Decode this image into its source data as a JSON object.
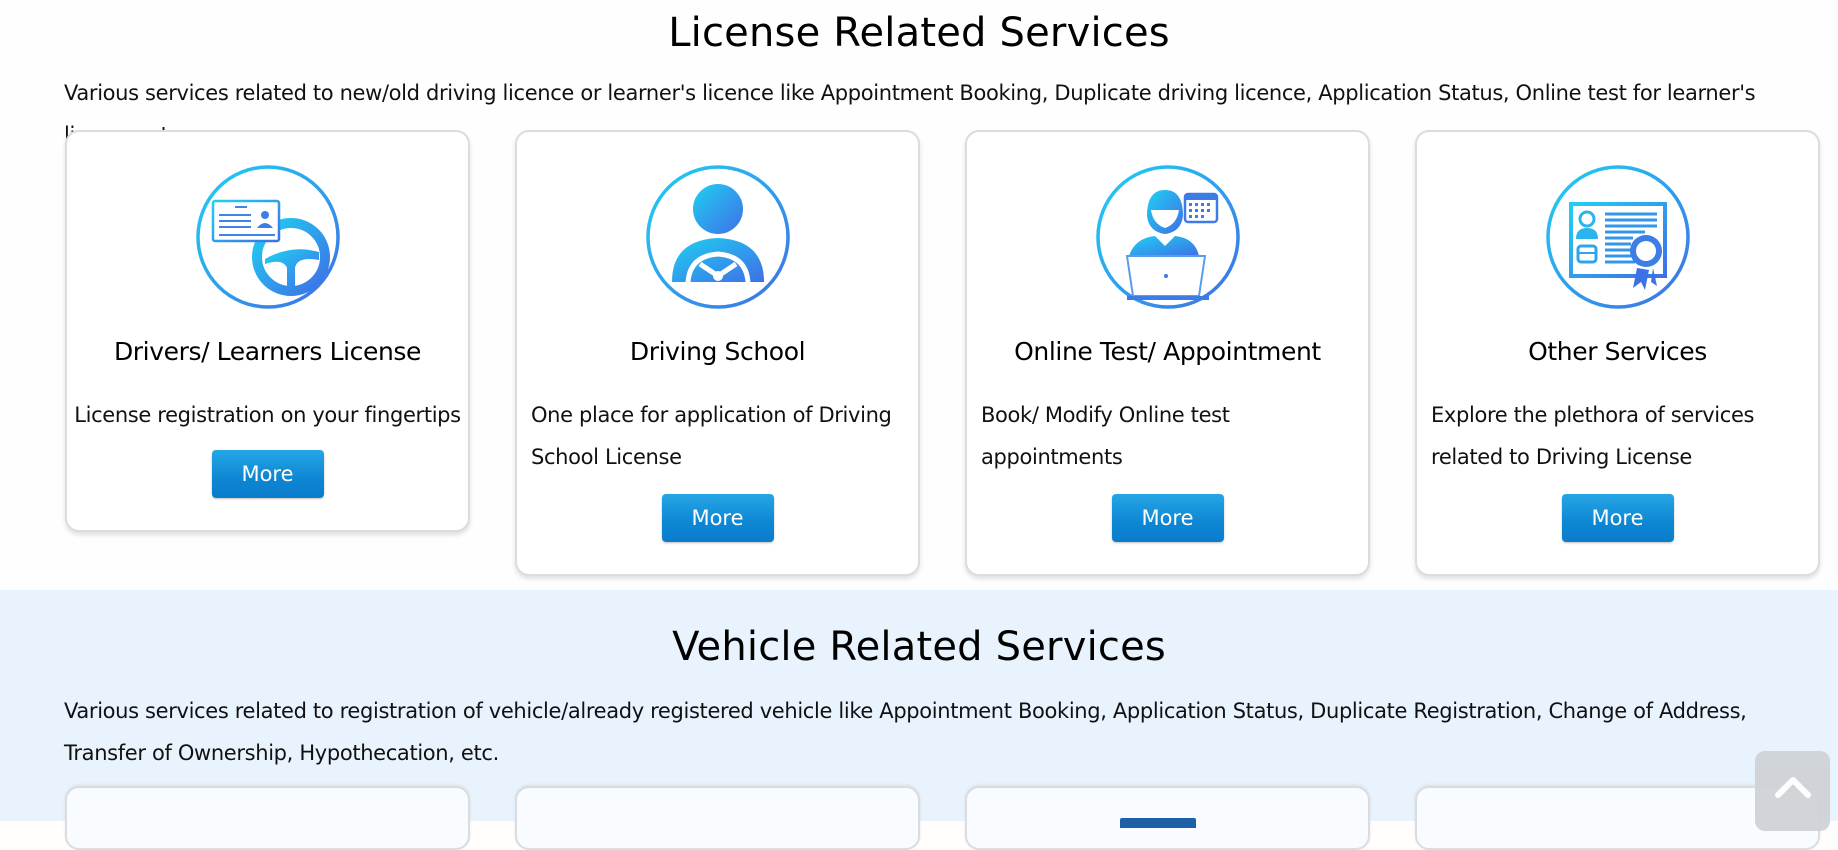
{
  "license_section": {
    "title": "License Related Services",
    "description": "Various services related to new/old driving licence or learner's licence like Appointment Booking, Duplicate driving licence, Application Status, Online test for learner's licence, etc.",
    "cards": [
      {
        "title": "Drivers/ Learners License",
        "description": "License registration on your fingertips",
        "button_label": "More",
        "icon": "license-steering-wheel-icon"
      },
      {
        "title": "Driving School",
        "description": "One place for application of Driving School License",
        "button_label": "More",
        "icon": "driver-steering-wheel-icon"
      },
      {
        "title": "Online Test/ Appointment",
        "description": "Book/ Modify Online test appointments",
        "button_label": "More",
        "icon": "person-laptop-calendar-icon"
      },
      {
        "title": "Other Services",
        "description": "Explore the plethora of services related to Driving License",
        "button_label": "More",
        "icon": "certificate-icon"
      }
    ]
  },
  "vehicle_section": {
    "title": "Vehicle Related Services",
    "description": "Various services related to registration of vehicle/already registered vehicle like Appointment Booking, Application Status, Duplicate Registration, Change of Address, Transfer of Ownership, Hypothecation, etc."
  },
  "scroll_top": {
    "icon": "chevron-up-icon"
  },
  "colors": {
    "icon_gradient_start": "#21c8f0",
    "icon_gradient_end": "#3c73e6",
    "button": "#0d86d3",
    "vehicle_bg": "#e9f3fd"
  }
}
